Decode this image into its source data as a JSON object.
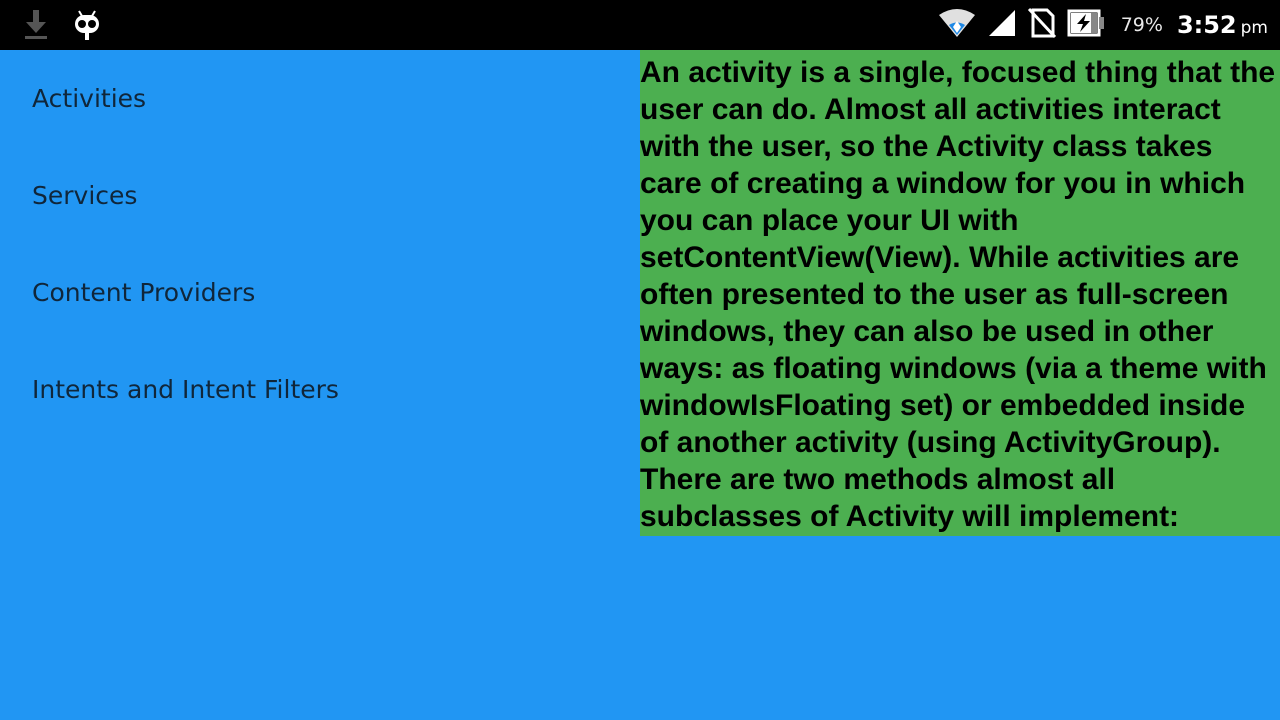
{
  "status_bar": {
    "left_icons": [
      "download-icon",
      "cyanogenmod-icon"
    ],
    "right_icons": [
      "wifi-icon",
      "cell-signal-icon",
      "no-sim-icon",
      "battery-icon"
    ],
    "battery_percent": "79%",
    "time": "3:52",
    "ampm": "pm"
  },
  "list": {
    "items": [
      {
        "label": "Activities"
      },
      {
        "label": "Services"
      },
      {
        "label": "Content Providers"
      },
      {
        "label": "Intents and Intent Filters"
      }
    ]
  },
  "detail": {
    "text": "An activity is a single, focused thing that the user can do. Almost all activities interact with the user, so the Activity class takes care of creating a window for you in which you can place your UI with setContentView(View). While activities are often presented to the user as full-screen windows, they can also be used in other ways: as floating windows (via a theme with windowIsFloating set) or embedded inside of another activity (using ActivityGroup). There are two methods almost all subclasses of Activity will implement:"
  },
  "colors": {
    "background": "#2196F3",
    "detail_background": "#4CAF50",
    "status_bar": "#000000"
  }
}
